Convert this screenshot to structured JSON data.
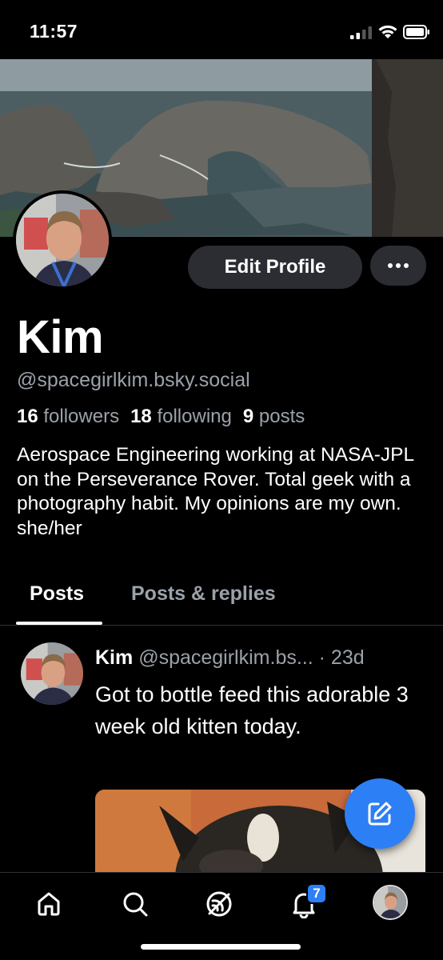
{
  "status_bar": {
    "time": "11:57"
  },
  "profile": {
    "display_name": "Kim",
    "handle": "@spacegirlkim.bsky.social",
    "followers_count": "16",
    "followers_label": "followers",
    "following_count": "18",
    "following_label": "following",
    "posts_count": "9",
    "posts_label": "posts",
    "bio": "Aerospace Engineering working at NASA-JPL on the Perseverance Rover. Total geek with a photography habit. My opinions are my own.  she/her",
    "edit_button_label": "Edit Profile",
    "more_button_icon": "ellipsis-icon"
  },
  "tabs": [
    {
      "label": "Posts",
      "selected": true
    },
    {
      "label": "Posts & replies",
      "selected": false
    }
  ],
  "feed": [
    {
      "author": "Kim",
      "handle": "@spacegirlkim.bs...",
      "separator": "·",
      "time": "23d",
      "text": "Got to bottle feed this adorable 3 week old kitten today.",
      "has_image": true
    }
  ],
  "fab": {
    "icon": "compose-icon"
  },
  "bottom_nav": {
    "items": [
      {
        "icon": "home-icon"
      },
      {
        "icon": "search-icon"
      },
      {
        "icon": "feeds-icon"
      },
      {
        "icon": "notifications-icon",
        "badge": "7"
      },
      {
        "icon": "profile-avatar"
      }
    ]
  },
  "colors": {
    "background": "#000000",
    "accent": "#2d7ff5",
    "secondary_text": "#9ba1aa",
    "button_bg": "#2b2d33"
  }
}
